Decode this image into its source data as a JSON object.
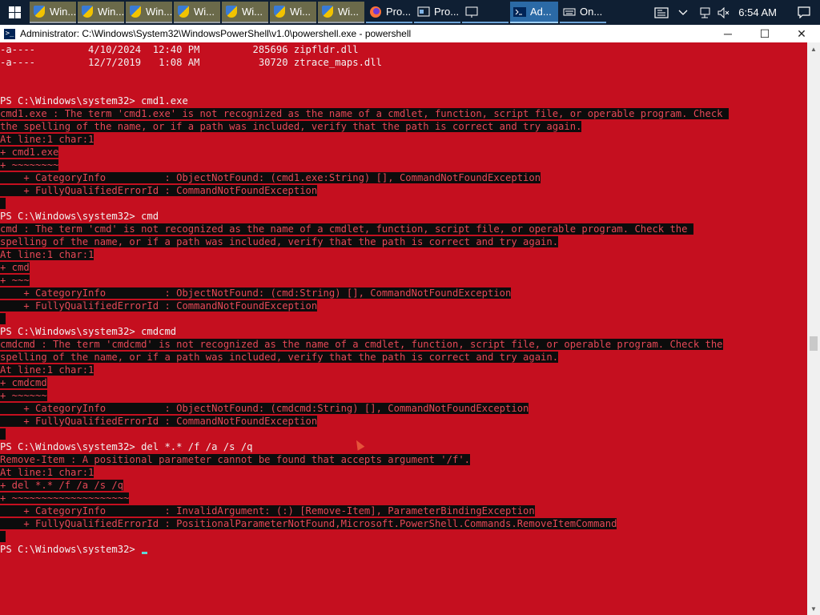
{
  "taskbar": {
    "buttons": [
      {
        "label": "Win...",
        "kind": "grp"
      },
      {
        "label": "Win...",
        "kind": "grp"
      },
      {
        "label": "Win...",
        "kind": "grp"
      },
      {
        "label": "Wi...",
        "kind": "grp"
      },
      {
        "label": "Wi...",
        "kind": "grp"
      },
      {
        "label": "Wi...",
        "kind": "grp"
      },
      {
        "label": "Wi...",
        "kind": "grp"
      },
      {
        "label": "Pro...",
        "kind": "app",
        "icon": "firefox-icon"
      },
      {
        "label": "Pro...",
        "kind": "app",
        "icon": "process-icon"
      },
      {
        "label": "",
        "kind": "app",
        "icon": "monitor-icon"
      },
      {
        "label": "Ad...",
        "kind": "active",
        "icon": "powershell-icon"
      },
      {
        "label": "On...",
        "kind": "app",
        "icon": "keyboard-icon"
      }
    ],
    "clock": "6:54 AM"
  },
  "window": {
    "title": "Administrator: C:\\Windows\\System32\\WindowsPowerShell\\v1.0\\powershell.exe - powershell",
    "minimize": "─",
    "maximize": "☐",
    "close": "✕"
  },
  "console": {
    "lines": [
      {
        "t": "-a----         4/10/2024  12:40 PM         285696 zipfldr.dll",
        "e": false
      },
      {
        "t": "-a----         12/7/2019   1:08 AM          30720 ztrace_maps.dll",
        "e": false
      },
      {
        "t": "",
        "e": false
      },
      {
        "t": "",
        "e": false
      },
      {
        "t": "PS C:\\Windows\\system32> cmd1.exe",
        "e": false
      },
      {
        "t": "cmd1.exe : The term 'cmd1.exe' is not recognized as the name of a cmdlet, function, script file, or operable program. Check ",
        "e": true
      },
      {
        "t": "the spelling of the name, or if a path was included, verify that the path is correct and try again.",
        "e": true
      },
      {
        "t": "At line:1 char:1",
        "e": true
      },
      {
        "t": "+ cmd1.exe",
        "e": true
      },
      {
        "t": "+ ~~~~~~~~",
        "e": true
      },
      {
        "t": "    + CategoryInfo          : ObjectNotFound: (cmd1.exe:String) [], CommandNotFoundException",
        "e": true
      },
      {
        "t": "    + FullyQualifiedErrorId : CommandNotFoundException",
        "e": true
      },
      {
        "t": " ",
        "e": true
      },
      {
        "t": "PS C:\\Windows\\system32> cmd",
        "e": false
      },
      {
        "t": "cmd : The term 'cmd' is not recognized as the name of a cmdlet, function, script file, or operable program. Check the ",
        "e": true
      },
      {
        "t": "spelling of the name, or if a path was included, verify that the path is correct and try again.",
        "e": true
      },
      {
        "t": "At line:1 char:1",
        "e": true
      },
      {
        "t": "+ cmd",
        "e": true
      },
      {
        "t": "+ ~~~",
        "e": true
      },
      {
        "t": "    + CategoryInfo          : ObjectNotFound: (cmd:String) [], CommandNotFoundException",
        "e": true
      },
      {
        "t": "    + FullyQualifiedErrorId : CommandNotFoundException",
        "e": true
      },
      {
        "t": " ",
        "e": true
      },
      {
        "t": "PS C:\\Windows\\system32> cmdcmd",
        "e": false
      },
      {
        "t": "cmdcmd : The term 'cmdcmd' is not recognized as the name of a cmdlet, function, script file, or operable program. Check the",
        "e": true
      },
      {
        "t": "spelling of the name, or if a path was included, verify that the path is correct and try again.",
        "e": true
      },
      {
        "t": "At line:1 char:1",
        "e": true
      },
      {
        "t": "+ cmdcmd",
        "e": true
      },
      {
        "t": "+ ~~~~~~",
        "e": true
      },
      {
        "t": "    + CategoryInfo          : ObjectNotFound: (cmdcmd:String) [], CommandNotFoundException",
        "e": true
      },
      {
        "t": "    + FullyQualifiedErrorId : CommandNotFoundException",
        "e": true
      },
      {
        "t": " ",
        "e": true
      },
      {
        "t": "PS C:\\Windows\\system32> del *.* /f /a /s /q",
        "e": false
      },
      {
        "t": "Remove-Item : A positional parameter cannot be found that accepts argument '/f'.",
        "e": true
      },
      {
        "t": "At line:1 char:1",
        "e": true
      },
      {
        "t": "+ del *.* /f /a /s /q",
        "e": true
      },
      {
        "t": "+ ~~~~~~~~~~~~~~~~~~~~",
        "e": true
      },
      {
        "t": "    + CategoryInfo          : InvalidArgument: (:) [Remove-Item], ParameterBindingException",
        "e": true
      },
      {
        "t": "    + FullyQualifiedErrorId : PositionalParameterNotFound,Microsoft.PowerShell.Commands.RemoveItemCommand",
        "e": true
      },
      {
        "t": " ",
        "e": true
      },
      {
        "t": "PS C:\\Windows\\system32> ",
        "e": false,
        "cursor": true
      }
    ]
  },
  "colors": {
    "console_bg": "#c50f1f",
    "error_fg": "#e74856",
    "error_bg": "#0c0c0c",
    "cursor": "#61d6d6"
  }
}
